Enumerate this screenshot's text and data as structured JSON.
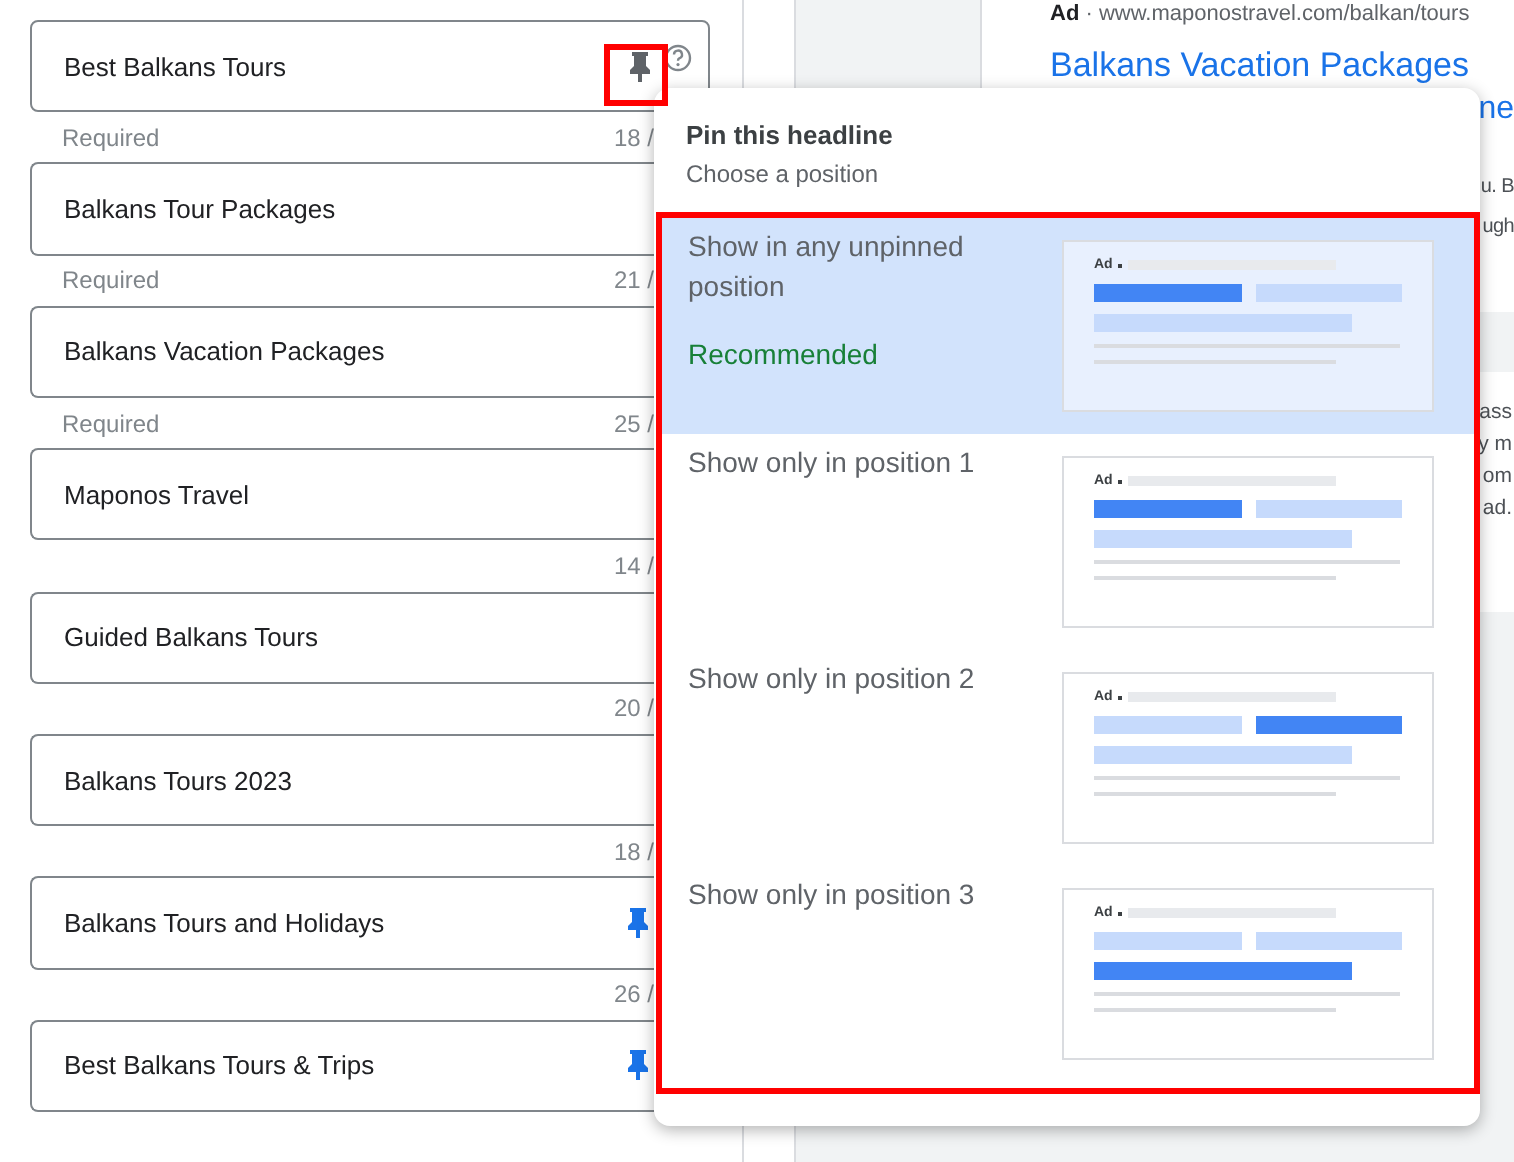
{
  "headlines": [
    {
      "text": "Best Balkans Tours",
      "note": "Required",
      "counter": "18 /",
      "pinned": false,
      "hovered": true
    },
    {
      "text": "Balkans Tour Packages",
      "note": "Required",
      "counter": "21 /",
      "pinned": false
    },
    {
      "text": "Balkans Vacation Packages",
      "note": "Required",
      "counter": "25 /",
      "pinned": false
    },
    {
      "text": "Maponos Travel",
      "counter": "14 /",
      "pinned": false
    },
    {
      "text": "Guided Balkans Tours",
      "counter": "20 /",
      "pinned": false
    },
    {
      "text": "Balkans Tours 2023",
      "counter": "18 /",
      "pinned": false
    },
    {
      "text": "Balkans Tours and Holidays",
      "counter": "26 /",
      "pinned": true
    },
    {
      "text": "Best Balkans Tours & Trips",
      "pinned": true
    }
  ],
  "preview": {
    "ad_label": "Ad",
    "url": "· www.maponostravel.com/balkan/tours",
    "headline": "Balkans Vacation Packages",
    "headline_2": "ne",
    "body_lines": [
      "u. B",
      "ugh"
    ],
    "second_card_lines": [
      "ass",
      "y m",
      "om",
      "ad."
    ]
  },
  "pin_menu": {
    "title": "Pin this headline",
    "subtitle": "Choose a position",
    "options": [
      {
        "label": "Show in any unpinned position",
        "note": "Recommended",
        "selected": true,
        "kind": "unpinned",
        "thumb_label": "Ad"
      },
      {
        "label": "Show only in position 1",
        "selected": false,
        "kind": "first",
        "thumb_label": "Ad"
      },
      {
        "label": "Show only in position 2",
        "selected": false,
        "kind": "second",
        "thumb_label": "Ad"
      },
      {
        "label": "Show only in position 3",
        "selected": false,
        "kind": "third",
        "thumb_label": "Ad"
      }
    ]
  }
}
